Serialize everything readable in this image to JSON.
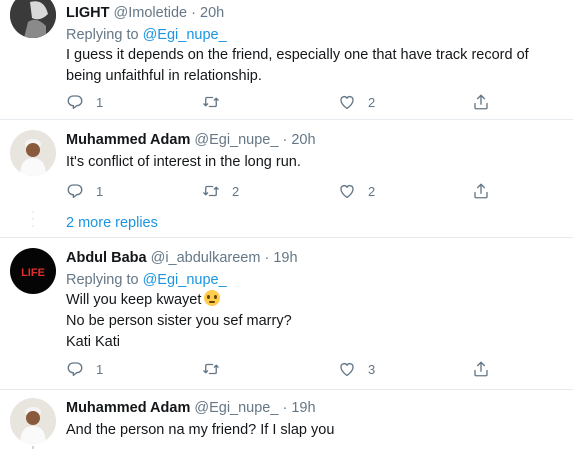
{
  "tweets": [
    {
      "name": "LIGHT",
      "handle": "@Imoletide",
      "dot": "·",
      "time": "20h",
      "replying_prefix": "Replying to",
      "replying_to": "@Egi_nupe_",
      "lines": [
        "I guess it depends on the friend, especially one that have track record of",
        "being unfaithful in relationship."
      ],
      "reply_count": "1",
      "retweet_count": "",
      "like_count": "2"
    },
    {
      "name": "Muhammed Adam",
      "handle": "@Egi_nupe_",
      "dot": "·",
      "time": "20h",
      "lines": [
        "It's conflict of interest in the long run."
      ],
      "reply_count": "1",
      "retweet_count": "2",
      "like_count": "2"
    },
    {
      "name": "Abdul Baba",
      "handle": "@i_abdulkareem",
      "dot": "·",
      "time": "19h",
      "avatar_text": "LIFE",
      "replying_prefix": "Replying to",
      "replying_to": "@Egi_nupe_",
      "lines": [
        "Will you keep kwayet",
        "No be person sister you sef marry?",
        "Kati Kati"
      ],
      "reply_count": "1",
      "retweet_count": "",
      "like_count": "3"
    },
    {
      "name": "Muhammed Adam",
      "handle": "@Egi_nupe_",
      "dot": "·",
      "time": "19h",
      "lines": [
        "And the person na my friend? If I slap you"
      ]
    }
  ],
  "more_replies": "2 more replies",
  "icons": {
    "reply": "reply-icon",
    "retweet": "retweet-icon",
    "like": "heart-icon",
    "share": "share-icon",
    "emoji": "face-with-rolling-eyes-emoji"
  },
  "colors": {
    "link": "#1b95e0",
    "muted": "#657786",
    "text": "#14171a",
    "divider": "#e6ecf0"
  }
}
